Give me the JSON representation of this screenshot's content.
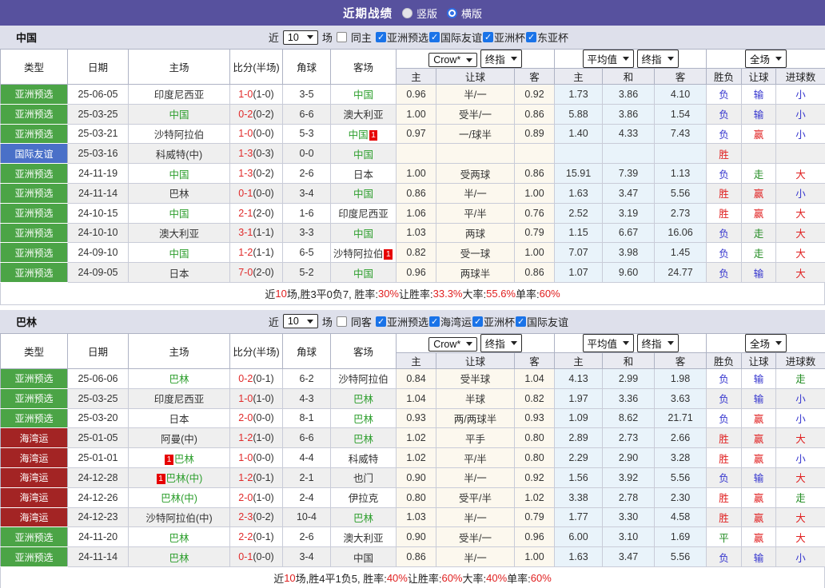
{
  "title_bar": {
    "title": "近期战绩",
    "radios": [
      {
        "label": "竖版",
        "checked": false
      },
      {
        "label": "横版",
        "checked": true
      }
    ]
  },
  "colors": {
    "topbar_purple": "#57519E",
    "type_green": "#4BA446",
    "type_blue": "#4A70C8",
    "type_dark_red": "#A32424",
    "highlight_team_green": "#2A9D2A",
    "score_red": "#E02A2A",
    "result_red": "#E02020",
    "result_blue": "#3535CE",
    "result_green": "#1F8A1F",
    "checkbox_blue": "#1A73E8",
    "odds_bg": "#FCF8EE",
    "avg_bg": "#E9F3FA"
  },
  "icons": {
    "checkbox_check": "✓",
    "select_arrow": "▼",
    "radio_dot": "●"
  },
  "header": {
    "left_cols": [
      "类型",
      "日期",
      "主场",
      "比分(半场)",
      "角球",
      "客场"
    ],
    "groups": [
      {
        "selects": [
          "Crow*",
          "终指"
        ],
        "cols": [
          "主",
          "让球",
          "客"
        ]
      },
      {
        "selects": [
          "平均值",
          "终指"
        ],
        "cols": [
          "主",
          "和",
          "客"
        ]
      },
      {
        "selects": [
          "全场"
        ],
        "cols": [
          "胜负",
          "让球",
          "进球数"
        ]
      }
    ]
  },
  "sections": [
    {
      "name": "中国",
      "filter": {
        "prefix": "近",
        "count": "10",
        "suffix": "场",
        "same_label": "同主",
        "same_checked": false,
        "comps": [
          {
            "label": "亚洲预选",
            "checked": true
          },
          {
            "label": "国际友谊",
            "checked": true
          },
          {
            "label": "亚洲杯",
            "checked": true
          },
          {
            "label": "东亚杯",
            "checked": true
          }
        ]
      },
      "rows": [
        {
          "type": "亚洲预选",
          "tc": "g",
          "date": "25-06-05",
          "home": "印度尼西亚",
          "home_hl": false,
          "home_badge": "",
          "score": "1-0",
          "half": "(1-0)",
          "corner": "3-5",
          "away": "中国",
          "away_hl": true,
          "away_badge": "",
          "odds": [
            "0.96",
            "半/一",
            "0.92"
          ],
          "avg": [
            "1.73",
            "3.86",
            "4.10"
          ],
          "results": [
            [
              "负",
              "b"
            ],
            [
              "输",
              "b"
            ],
            [
              "小",
              "b"
            ]
          ]
        },
        {
          "type": "亚洲预选",
          "tc": "g",
          "date": "25-03-25",
          "home": "中国",
          "home_hl": true,
          "home_badge": "",
          "score": "0-2",
          "half": "(0-2)",
          "corner": "6-6",
          "away": "澳大利亚",
          "away_hl": false,
          "away_badge": "",
          "odds": [
            "1.00",
            "受半/一",
            "0.86"
          ],
          "avg": [
            "5.88",
            "3.86",
            "1.54"
          ],
          "results": [
            [
              "负",
              "b"
            ],
            [
              "输",
              "b"
            ],
            [
              "小",
              "b"
            ]
          ]
        },
        {
          "type": "亚洲预选",
          "tc": "g",
          "date": "25-03-21",
          "home": "沙特阿拉伯",
          "home_hl": false,
          "home_badge": "",
          "score": "1-0",
          "half": "(0-0)",
          "corner": "5-3",
          "away": "中国",
          "away_hl": true,
          "away_badge": "1",
          "odds": [
            "0.97",
            "一/球半",
            "0.89"
          ],
          "avg": [
            "1.40",
            "4.33",
            "7.43"
          ],
          "results": [
            [
              "负",
              "b"
            ],
            [
              "赢",
              "r"
            ],
            [
              "小",
              "b"
            ]
          ]
        },
        {
          "type": "国际友谊",
          "tc": "b",
          "date": "25-03-16",
          "home": "科威特(中)",
          "home_hl": false,
          "home_badge": "",
          "score": "1-3",
          "half": "(0-3)",
          "corner": "0-0",
          "away": "中国",
          "away_hl": true,
          "away_badge": "",
          "odds": [
            "",
            "",
            ""
          ],
          "avg": [
            "",
            "",
            ""
          ],
          "results": [
            [
              "胜",
              "r"
            ],
            [
              "",
              ""
            ],
            [
              "",
              ""
            ]
          ]
        },
        {
          "type": "亚洲预选",
          "tc": "g",
          "date": "24-11-19",
          "home": "中国",
          "home_hl": true,
          "home_badge": "",
          "score": "1-3",
          "half": "(0-2)",
          "corner": "2-6",
          "away": "日本",
          "away_hl": false,
          "away_badge": "",
          "odds": [
            "1.00",
            "受两球",
            "0.86"
          ],
          "avg": [
            "15.91",
            "7.39",
            "1.13"
          ],
          "results": [
            [
              "负",
              "b"
            ],
            [
              "走",
              "g"
            ],
            [
              "大",
              "r"
            ]
          ]
        },
        {
          "type": "亚洲预选",
          "tc": "g",
          "date": "24-11-14",
          "home": "巴林",
          "home_hl": false,
          "home_badge": "",
          "score": "0-1",
          "half": "(0-0)",
          "corner": "3-4",
          "away": "中国",
          "away_hl": true,
          "away_badge": "",
          "odds": [
            "0.86",
            "半/一",
            "1.00"
          ],
          "avg": [
            "1.63",
            "3.47",
            "5.56"
          ],
          "results": [
            [
              "胜",
              "r"
            ],
            [
              "赢",
              "r"
            ],
            [
              "小",
              "b"
            ]
          ]
        },
        {
          "type": "亚洲预选",
          "tc": "g",
          "date": "24-10-15",
          "home": "中国",
          "home_hl": true,
          "home_badge": "",
          "score": "2-1",
          "half": "(2-0)",
          "corner": "1-6",
          "away": "印度尼西亚",
          "away_hl": false,
          "away_badge": "",
          "odds": [
            "1.06",
            "平/半",
            "0.76"
          ],
          "avg": [
            "2.52",
            "3.19",
            "2.73"
          ],
          "results": [
            [
              "胜",
              "r"
            ],
            [
              "赢",
              "r"
            ],
            [
              "大",
              "r"
            ]
          ]
        },
        {
          "type": "亚洲预选",
          "tc": "g",
          "date": "24-10-10",
          "home": "澳大利亚",
          "home_hl": false,
          "home_badge": "",
          "score": "3-1",
          "half": "(1-1)",
          "corner": "3-3",
          "away": "中国",
          "away_hl": true,
          "away_badge": "",
          "odds": [
            "1.03",
            "两球",
            "0.79"
          ],
          "avg": [
            "1.15",
            "6.67",
            "16.06"
          ],
          "results": [
            [
              "负",
              "b"
            ],
            [
              "走",
              "g"
            ],
            [
              "大",
              "r"
            ]
          ]
        },
        {
          "type": "亚洲预选",
          "tc": "g",
          "date": "24-09-10",
          "home": "中国",
          "home_hl": true,
          "home_badge": "",
          "score": "1-2",
          "half": "(1-1)",
          "corner": "6-5",
          "away": "沙特阿拉伯",
          "away_hl": false,
          "away_badge": "1",
          "odds": [
            "0.82",
            "受一球",
            "1.00"
          ],
          "avg": [
            "7.07",
            "3.98",
            "1.45"
          ],
          "results": [
            [
              "负",
              "b"
            ],
            [
              "走",
              "g"
            ],
            [
              "大",
              "r"
            ]
          ]
        },
        {
          "type": "亚洲预选",
          "tc": "g",
          "date": "24-09-05",
          "home": "日本",
          "home_hl": false,
          "home_badge": "",
          "score": "7-0",
          "half": "(2-0)",
          "corner": "5-2",
          "away": "中国",
          "away_hl": true,
          "away_badge": "",
          "odds": [
            "0.96",
            "两球半",
            "0.86"
          ],
          "avg": [
            "1.07",
            "9.60",
            "24.77"
          ],
          "results": [
            [
              "负",
              "b"
            ],
            [
              "输",
              "b"
            ],
            [
              "大",
              "r"
            ]
          ]
        }
      ],
      "summary": [
        {
          "text": "近",
          "red": false
        },
        {
          "text": "10",
          "red": true
        },
        {
          "text": "场,胜3平0负7, 胜率:",
          "red": false
        },
        {
          "text": "30%",
          "red": true
        },
        {
          "text": " 让胜率:",
          "red": false
        },
        {
          "text": "33.3%",
          "red": true
        },
        {
          "text": " 大率:",
          "red": false
        },
        {
          "text": "55.6%",
          "red": true
        },
        {
          "text": " 单率:",
          "red": false
        },
        {
          "text": "60%",
          "red": true
        }
      ]
    },
    {
      "name": "巴林",
      "filter": {
        "prefix": "近",
        "count": "10",
        "suffix": "场",
        "same_label": "同客",
        "same_checked": false,
        "comps": [
          {
            "label": "亚洲预选",
            "checked": true
          },
          {
            "label": "海湾运",
            "checked": true
          },
          {
            "label": "亚洲杯",
            "checked": true
          },
          {
            "label": "国际友谊",
            "checked": true
          }
        ]
      },
      "rows": [
        {
          "type": "亚洲预选",
          "tc": "g",
          "date": "25-06-06",
          "home": "巴林",
          "home_hl": true,
          "home_badge": "",
          "score": "0-2",
          "half": "(0-1)",
          "corner": "6-2",
          "away": "沙特阿拉伯",
          "away_hl": false,
          "away_badge": "",
          "odds": [
            "0.84",
            "受半球",
            "1.04"
          ],
          "avg": [
            "4.13",
            "2.99",
            "1.98"
          ],
          "results": [
            [
              "负",
              "b"
            ],
            [
              "输",
              "b"
            ],
            [
              "走",
              "g"
            ]
          ]
        },
        {
          "type": "亚洲预选",
          "tc": "g",
          "date": "25-03-25",
          "home": "印度尼西亚",
          "home_hl": false,
          "home_badge": "",
          "score": "1-0",
          "half": "(1-0)",
          "corner": "4-3",
          "away": "巴林",
          "away_hl": true,
          "away_badge": "",
          "odds": [
            "1.04",
            "半球",
            "0.82"
          ],
          "avg": [
            "1.97",
            "3.36",
            "3.63"
          ],
          "results": [
            [
              "负",
              "b"
            ],
            [
              "输",
              "b"
            ],
            [
              "小",
              "b"
            ]
          ]
        },
        {
          "type": "亚洲预选",
          "tc": "g",
          "date": "25-03-20",
          "home": "日本",
          "home_hl": false,
          "home_badge": "",
          "score": "2-0",
          "half": "(0-0)",
          "corner": "8-1",
          "away": "巴林",
          "away_hl": true,
          "away_badge": "",
          "odds": [
            "0.93",
            "两/两球半",
            "0.93"
          ],
          "avg": [
            "1.09",
            "8.62",
            "21.71"
          ],
          "results": [
            [
              "负",
              "b"
            ],
            [
              "赢",
              "r"
            ],
            [
              "小",
              "b"
            ]
          ]
        },
        {
          "type": "海湾运",
          "tc": "r",
          "date": "25-01-05",
          "home": "阿曼(中)",
          "home_hl": false,
          "home_badge": "",
          "score": "1-2",
          "half": "(1-0)",
          "corner": "6-6",
          "away": "巴林",
          "away_hl": true,
          "away_badge": "",
          "odds": [
            "1.02",
            "平手",
            "0.80"
          ],
          "avg": [
            "2.89",
            "2.73",
            "2.66"
          ],
          "results": [
            [
              "胜",
              "r"
            ],
            [
              "赢",
              "r"
            ],
            [
              "大",
              "r"
            ]
          ]
        },
        {
          "type": "海湾运",
          "tc": "r",
          "date": "25-01-01",
          "home": "巴林",
          "home_hl": true,
          "home_badge": "1",
          "score": "1-0",
          "half": "(0-0)",
          "corner": "4-4",
          "away": "科威特",
          "away_hl": false,
          "away_badge": "",
          "odds": [
            "1.02",
            "平/半",
            "0.80"
          ],
          "avg": [
            "2.29",
            "2.90",
            "3.28"
          ],
          "results": [
            [
              "胜",
              "r"
            ],
            [
              "赢",
              "r"
            ],
            [
              "小",
              "b"
            ]
          ]
        },
        {
          "type": "海湾运",
          "tc": "r",
          "date": "24-12-28",
          "home": "巴林(中)",
          "home_hl": true,
          "home_badge": "1",
          "score": "1-2",
          "half": "(0-1)",
          "corner": "2-1",
          "away": "也门",
          "away_hl": false,
          "away_badge": "",
          "odds": [
            "0.90",
            "半/一",
            "0.92"
          ],
          "avg": [
            "1.56",
            "3.92",
            "5.56"
          ],
          "results": [
            [
              "负",
              "b"
            ],
            [
              "输",
              "b"
            ],
            [
              "大",
              "r"
            ]
          ]
        },
        {
          "type": "海湾运",
          "tc": "r",
          "date": "24-12-26",
          "home": "巴林(中)",
          "home_hl": true,
          "home_badge": "",
          "score": "2-0",
          "half": "(1-0)",
          "corner": "2-4",
          "away": "伊拉克",
          "away_hl": false,
          "away_badge": "",
          "odds": [
            "0.80",
            "受平/半",
            "1.02"
          ],
          "avg": [
            "3.38",
            "2.78",
            "2.30"
          ],
          "results": [
            [
              "胜",
              "r"
            ],
            [
              "赢",
              "r"
            ],
            [
              "走",
              "g"
            ]
          ]
        },
        {
          "type": "海湾运",
          "tc": "r",
          "date": "24-12-23",
          "home": "沙特阿拉伯(中)",
          "home_hl": false,
          "home_badge": "",
          "score": "2-3",
          "half": "(0-2)",
          "corner": "10-4",
          "away": "巴林",
          "away_hl": true,
          "away_badge": "",
          "odds": [
            "1.03",
            "半/一",
            "0.79"
          ],
          "avg": [
            "1.77",
            "3.30",
            "4.58"
          ],
          "results": [
            [
              "胜",
              "r"
            ],
            [
              "赢",
              "r"
            ],
            [
              "大",
              "r"
            ]
          ]
        },
        {
          "type": "亚洲预选",
          "tc": "g",
          "date": "24-11-20",
          "home": "巴林",
          "home_hl": true,
          "home_badge": "",
          "score": "2-2",
          "half": "(0-1)",
          "corner": "2-6",
          "away": "澳大利亚",
          "away_hl": false,
          "away_badge": "",
          "odds": [
            "0.90",
            "受半/一",
            "0.96"
          ],
          "avg": [
            "6.00",
            "3.10",
            "1.69"
          ],
          "results": [
            [
              "平",
              "g"
            ],
            [
              "赢",
              "r"
            ],
            [
              "大",
              "r"
            ]
          ]
        },
        {
          "type": "亚洲预选",
          "tc": "g",
          "date": "24-11-14",
          "home": "巴林",
          "home_hl": true,
          "home_badge": "",
          "score": "0-1",
          "half": "(0-0)",
          "corner": "3-4",
          "away": "中国",
          "away_hl": false,
          "away_badge": "",
          "odds": [
            "0.86",
            "半/一",
            "1.00"
          ],
          "avg": [
            "1.63",
            "3.47",
            "5.56"
          ],
          "results": [
            [
              "负",
              "b"
            ],
            [
              "输",
              "b"
            ],
            [
              "小",
              "b"
            ]
          ]
        }
      ],
      "summary": [
        {
          "text": "近",
          "red": false
        },
        {
          "text": "10",
          "red": true
        },
        {
          "text": "场,胜4平1负5, 胜率:",
          "red": false
        },
        {
          "text": "40%",
          "red": true
        },
        {
          "text": " 让胜率:",
          "red": false
        },
        {
          "text": "60%",
          "red": true
        },
        {
          "text": " 大率:",
          "red": false
        },
        {
          "text": "40%",
          "red": true
        },
        {
          "text": " 单率:",
          "red": false
        },
        {
          "text": "60%",
          "red": true
        }
      ]
    }
  ]
}
